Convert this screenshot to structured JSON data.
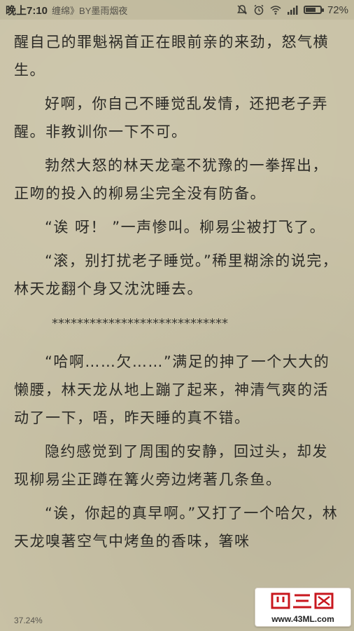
{
  "status_bar": {
    "time": "晚上7:10",
    "book_title": "缠绵》BY墨雨烟夜",
    "battery_percent": "72%",
    "battery_level": 0.72,
    "icons": [
      "notification-mute-icon",
      "alarm-icon",
      "wifi-icon",
      "signal-icon",
      "battery-icon"
    ]
  },
  "reader": {
    "paragraphs": [
      {
        "text": "醒自己的罪魁祸首正在眼前亲的来劲，怒气横生。",
        "indent": false
      },
      {
        "text": "好啊，你自己不睡觉乱发情，还把老子弄醒。非教训你一下不可。",
        "indent": true
      },
      {
        "text": "勃然大怒的林天龙毫不犹豫的一拳挥出，正吻的投入的柳易尘完全没有防备。",
        "indent": true
      },
      {
        "text": "“诶 呀！ ”一声惨叫。柳易尘被打飞了。",
        "indent": true
      },
      {
        "text": "“滚，别打扰老子睡觉。”稀里糊涂的说完，林天龙翻个身又沈沈睡去。",
        "indent": true
      }
    ],
    "separator": "****************************",
    "paragraphs_after": [
      {
        "text": "“哈啊……欠……”满足的抻了一个大大的懒腰，林天龙从地上蹦了起来，神清气爽的活动了一下，唔，昨天睡的真不错。",
        "indent": true
      },
      {
        "text": "隐约感觉到了周围的安静，回过头，却发现柳易尘正蹲在篝火旁边烤著几条鱼。",
        "indent": true
      },
      {
        "text": "“诶，你起的真早啊。”又打了一个哈欠，林天龙嗅著空气中烤鱼的香味，箸咪",
        "indent": true
      }
    ],
    "progress": "37.24%"
  },
  "watermark": {
    "logo_text": "四三网",
    "url": "www.43ML.com"
  }
}
